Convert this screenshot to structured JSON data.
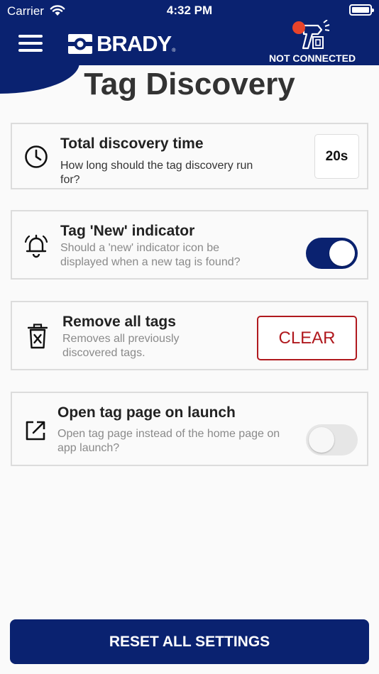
{
  "status_bar": {
    "carrier": "Carrier",
    "time": "4:32 PM"
  },
  "header": {
    "brand": "BRADY",
    "brand_mark": "®",
    "connection_status": "NOT CONNECTED",
    "status_dot_color": "#e8432a",
    "background_color": "#0a2270"
  },
  "page": {
    "title": "Tag Discovery"
  },
  "settings": [
    {
      "icon": "clock-icon",
      "title": "Total discovery time",
      "description": "How long should the tag discovery run for?",
      "value": "20s"
    },
    {
      "icon": "bell-icon",
      "title": "Tag 'New' indicator",
      "description": "Should a 'new' indicator icon be displayed when a new tag is found?",
      "toggle": "on"
    },
    {
      "icon": "trash-icon",
      "title": "Remove all tags",
      "description": "Removes all previously discovered tags.",
      "button_label": "CLEAR",
      "button_color": "#b0191e"
    },
    {
      "icon": "external-link-icon",
      "title": "Open tag page on launch",
      "description": "Open tag page instead of the home page on app launch?",
      "toggle": "off"
    }
  ],
  "footer": {
    "reset_label": "RESET ALL SETTINGS"
  }
}
